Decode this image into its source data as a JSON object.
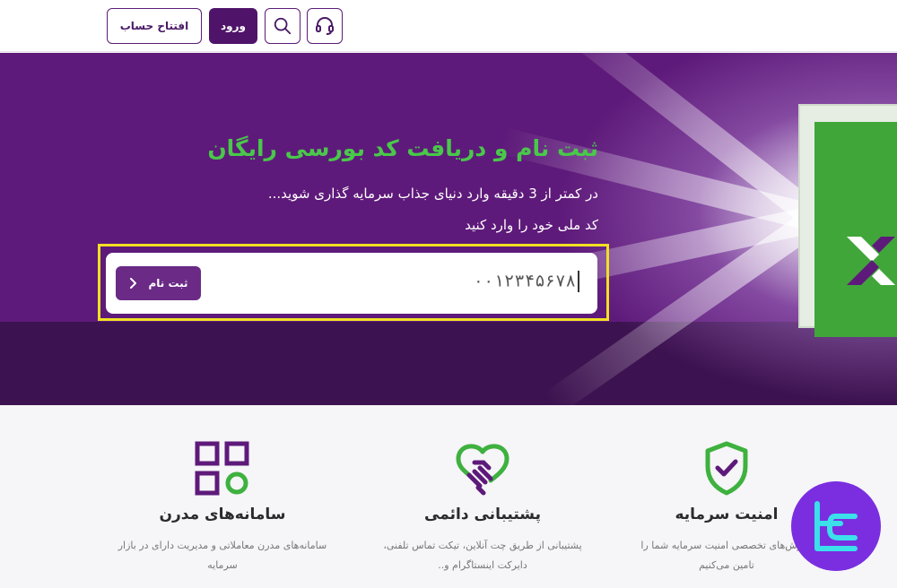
{
  "header": {
    "open_account_label": "افتتاح حساب",
    "login_label": "ورود",
    "search_icon": "search-icon",
    "support_icon": "headset-icon"
  },
  "hero": {
    "title": "ثبت نام و دریافت کد بورسی رایگان",
    "subtitle": "در کمتر از 3 دقیقه وارد دنیای جذاب سرمایه گذاری شوید...",
    "field_label": "کد ملی خود را وارد کنید",
    "input_value": "۰۰۱۲۳۴۵۶۷۸",
    "register_label": "ثبت نام",
    "accent_color": "#49c84a",
    "background_color": "#5e1a7a"
  },
  "features": [
    {
      "icon": "grid-icon",
      "title": "سامانه‌های مدرن",
      "desc_line1": "سامانه‌های مدرن معاملاتی و مدیریت دارای در بازار",
      "desc_line2": "سرمایه"
    },
    {
      "icon": "handshake-icon",
      "title": "پشتیبانی دائمی",
      "desc_line1": "پشتیبانی از طریق چت آنلاین، تیکت تماس تلفنی،",
      "desc_line2": "دایرکت اینستاگرام و.."
    },
    {
      "icon": "shield-check-icon",
      "title": "امنیت سرمایه",
      "desc_line1": "موزش‌های تخصصی امنیت سرمایه شما را",
      "desc_line2": "تامین می‌کنیم"
    }
  ]
}
